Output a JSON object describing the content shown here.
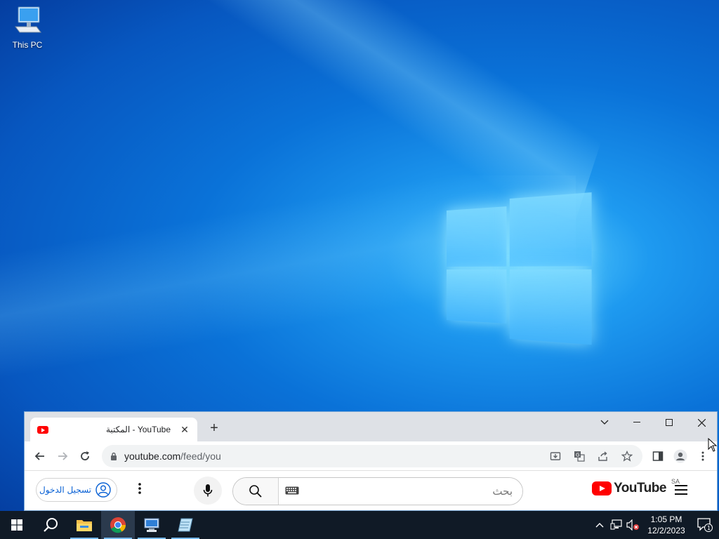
{
  "desktop": {
    "icons": [
      {
        "label": "This PC",
        "icon": "computer-icon"
      }
    ]
  },
  "browser": {
    "tab": {
      "title": "المكتبة - YouTube",
      "favicon": "youtube-favicon-icon"
    },
    "new_tab": "+",
    "window_controls": {
      "tab_search": "⌄",
      "minimize": "–",
      "maximize": "☐",
      "close": "✕"
    },
    "url_host": "youtube.com",
    "url_path": "/feed/you",
    "toolbar_icons": [
      "back-icon",
      "forward-icon",
      "reload-icon",
      "lock-icon",
      "install-icon",
      "translate-icon",
      "share-icon",
      "bookmark-star-icon",
      "side-panel-icon",
      "profile-icon",
      "menu-icon"
    ]
  },
  "youtube": {
    "sign_in_label": "تسجيل الدخول",
    "search_placeholder": "بحث",
    "logo_text": "YouTube",
    "country_code": "SA",
    "brand_color": "#ff0000"
  },
  "taskbar": {
    "items": [
      "start-icon",
      "search-icon",
      "file-explorer-icon",
      "chrome-icon",
      "network-computer-icon",
      "notepad-icon"
    ],
    "time": "1:05 PM",
    "date": "12/2/2023",
    "notification_count": "1"
  }
}
